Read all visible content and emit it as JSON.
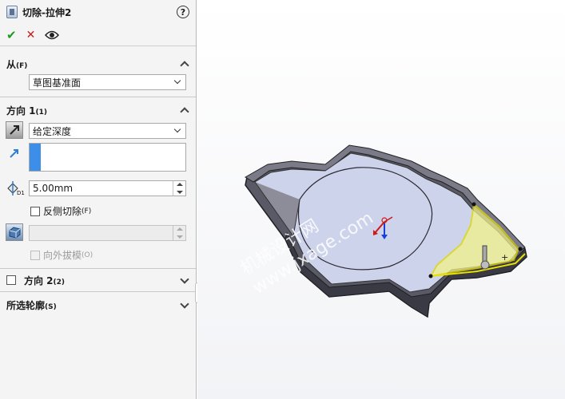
{
  "header": {
    "title": "切除-拉伸2",
    "help_label": "?"
  },
  "actions": {
    "ok_icon": "✔",
    "cancel_icon": "✕",
    "preview_icon": "eye"
  },
  "from": {
    "label": "从",
    "mnemonic": "(F)",
    "selected": "草图基准面"
  },
  "direction1": {
    "label": "方向 1",
    "mnemonic": "(1)",
    "end_condition": "给定深度",
    "depth_value": "5.00mm",
    "flip_side_label": "反侧切除",
    "flip_side_mnemonic": "(F)",
    "draft_value": "",
    "draft_outward_label": "向外拔模",
    "draft_outward_mnemonic": "(O)"
  },
  "direction2": {
    "label": "方向 2",
    "mnemonic": "(2)"
  },
  "selected_contours": {
    "label": "所选轮廓",
    "mnemonic": "(S)"
  },
  "viewport": {
    "watermark_line1": "机械设计网",
    "watermark_line2": "www.jxage.com"
  },
  "colors": {
    "panel_bg": "#f4f4f4",
    "accent_blue": "#2d7fd6",
    "ok_green": "#1f9a1f",
    "cancel_red": "#c21b1b",
    "model_wall": "#5a5a66",
    "model_floor": "#cdd3ea",
    "selection_yellow": "#f2f28a"
  }
}
